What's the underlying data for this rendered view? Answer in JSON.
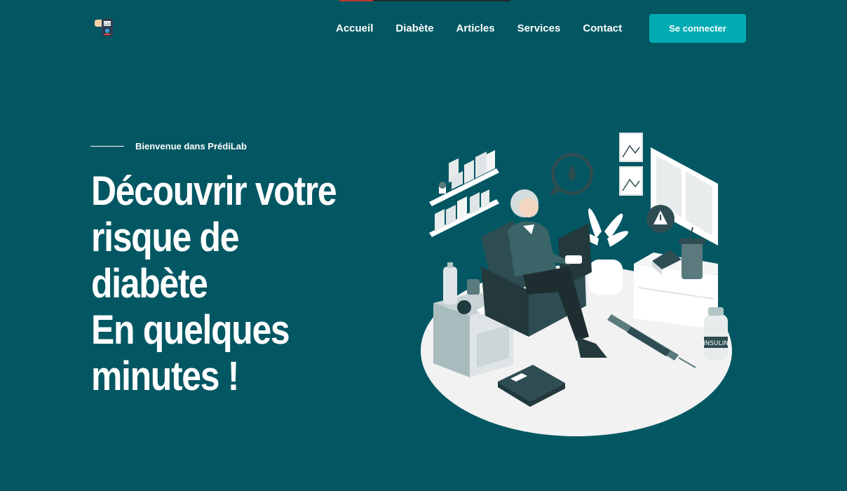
{
  "brand": {
    "logo": "predilab-logo-icon"
  },
  "nav": {
    "items": [
      {
        "label": "Accueil"
      },
      {
        "label": "Diabète"
      },
      {
        "label": "Articles"
      },
      {
        "label": "Services"
      },
      {
        "label": "Contact"
      }
    ],
    "login_label": "Se connecter"
  },
  "hero": {
    "welcome": "Bienvenue dans PrédiLab",
    "title_lines": [
      "Découvrir votre",
      "risque de",
      "diabète",
      "En quelques",
      "minutes !"
    ],
    "illustration": "elderly-man-checking-glucose-illustration"
  },
  "illustration_text": {
    "vial_label": "INSULIN"
  },
  "colors": {
    "background": "#025763",
    "accent": "#00abb3",
    "text": "#ffffff"
  }
}
